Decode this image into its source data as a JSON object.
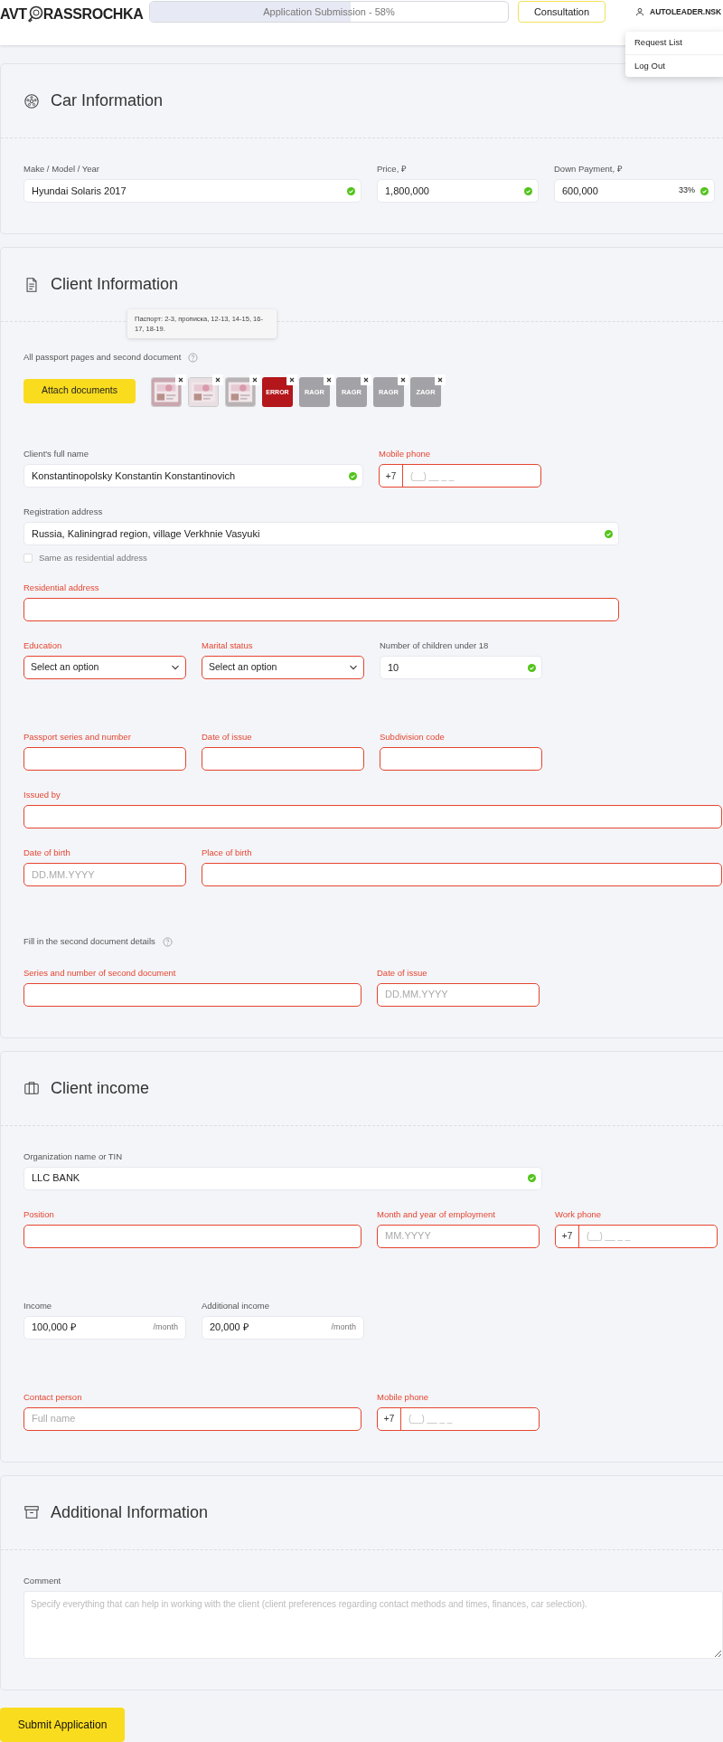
{
  "header": {
    "logo_left": "AVT",
    "logo_right": "RASSROCHKA",
    "progress": {
      "label": "Application Submission - 58%",
      "level": 0.56
    },
    "consultation": "Consultation",
    "user": "AUTOLEADER.NSK",
    "menu": [
      "Request List",
      "Log Out"
    ]
  },
  "sections": [
    {
      "kind": "car",
      "title": "Car Information",
      "groups": [
        {
          "rows": [
            [
              {
                "kind": "text",
                "label": "Make / Model / Year",
                "value": "Hyundai Solaris 2017",
                "valid": true,
                "error": false
              },
              {
                "kind": "text",
                "label": "Price, ₽",
                "value": "1,800,000",
                "valid": true,
                "error": false
              },
              {
                "kind": "text",
                "label": "Down Payment, ₽",
                "value": "600,000",
                "badge": "33%",
                "valid": true,
                "error": false
              }
            ]
          ]
        }
      ]
    },
    {
      "kind": "document",
      "title": "Client Information",
      "documents": {
        "tooltip": "Паспорт: 2-3, прописка, 12-13, 14-15, 16-17, 18-19.",
        "label": "All passport pages and second document",
        "button": "Attach documents",
        "files": [
          {
            "kind": "picture"
          },
          {
            "kind": "picture"
          },
          {
            "kind": "picture"
          },
          {
            "kind": "error",
            "text": "ERROR"
          },
          {
            "kind": "pending",
            "text": "RAGR"
          },
          {
            "kind": "pending",
            "text": "RAGR"
          },
          {
            "kind": "pending",
            "text": "RAGR"
          },
          {
            "kind": "pending",
            "text": "ZAGR"
          }
        ]
      },
      "groups": [
        {
          "rows": [
            [
              {
                "kind": "text",
                "label": "Client's full name",
                "value": "Konstantinopolsky Konstantin Konstantinovich",
                "valid": true,
                "error": false
              },
              {
                "kind": "phone",
                "label": "Mobile phone",
                "prefix": "+7",
                "placeholder": "(__) __ _ _",
                "valid": false,
                "error": true
              }
            ]
          ]
        },
        {
          "rows": [
            [
              {
                "kind": "text",
                "label": "Registration address",
                "value": "Russia, Kaliningrad region, village Verkhnie Vasyuki",
                "valid": true,
                "error": false
              }
            ],
            [
              {
                "kind": "checkbox",
                "label": "Same as residential address",
                "checked": false
              }
            ],
            [
              {
                "kind": "text",
                "label": "Residential address",
                "valid": false,
                "error": true
              }
            ],
            [
              {
                "kind": "select",
                "label": "Education",
                "value": "Select an option",
                "error": true
              },
              {
                "kind": "select",
                "label": "Marital status",
                "value": "Select an option",
                "error": true
              },
              {
                "kind": "text",
                "label": "Number of children under 18",
                "value": "10",
                "valid": true,
                "error": false
              }
            ]
          ]
        },
        {
          "rows": [
            [
              {
                "kind": "text",
                "label": "Passport series and number",
                "valid": false,
                "error": true
              },
              {
                "kind": "text",
                "label": "Date of issue",
                "valid": false,
                "error": true
              },
              {
                "kind": "text",
                "label": "Subdivision code",
                "valid": false,
                "error": true
              }
            ],
            [
              {
                "kind": "text",
                "label": "Issued by",
                "valid": false,
                "error": true
              }
            ],
            [
              {
                "kind": "text",
                "label": "Date of birth",
                "placeholder": "DD.MM.YYYY",
                "valid": false,
                "error": true
              },
              {
                "kind": "text",
                "label": "Place of birth",
                "valid": false,
                "error": true
              }
            ]
          ]
        },
        {
          "rows": [
            [
              {
                "kind": "note",
                "label": "Fill in the second document details"
              }
            ],
            [
              {
                "kind": "text",
                "label": "Series and number of second document",
                "valid": false,
                "error": true
              },
              {
                "kind": "text",
                "label": "Date of issue",
                "placeholder": "DD.MM.YYYY",
                "valid": false,
                "error": true
              }
            ]
          ]
        }
      ]
    },
    {
      "kind": "briefcase",
      "title": "Client income",
      "groups": [
        {
          "rows": [
            [
              {
                "kind": "text",
                "label": "Organization name or TIN",
                "value": "LLC BANK",
                "valid": true,
                "error": false
              }
            ],
            [
              {
                "kind": "text",
                "label": "Position",
                "valid": false,
                "error": true
              },
              {
                "kind": "text",
                "label": "Month and year of employment",
                "placeholder": "MM.YYYY",
                "valid": false,
                "error": true
              },
              {
                "kind": "phone",
                "label": "Work phone",
                "prefix": "+7",
                "placeholder": "(__) __ _ _",
                "valid": false,
                "error": true
              }
            ]
          ]
        },
        {
          "rows": [
            [
              {
                "kind": "money",
                "label": "Income",
                "value": "100,000 ₽",
                "suffix": "/month",
                "valid": false,
                "error": false
              },
              {
                "kind": "money",
                "label": "Additional income",
                "value": "20,000 ₽",
                "suffix": "/month",
                "valid": false,
                "error": false
              }
            ]
          ]
        },
        {
          "rows": [
            [
              {
                "kind": "text",
                "label": "Contact person",
                "placeholder": "Full name",
                "valid": false,
                "error": true
              },
              {
                "kind": "phone",
                "label": "Mobile phone",
                "prefix": "+7",
                "placeholder": "(__) __ _ _",
                "valid": false,
                "error": true
              }
            ]
          ]
        }
      ]
    },
    {
      "kind": "archive",
      "title": "Additional Information",
      "groups": [
        {
          "rows": [
            [
              {
                "kind": "textarea",
                "label": "Comment",
                "placeholder": "Specify everything that can help in working with the client (client preferences regarding contact methods and times, finances, car selection).",
                "error": false
              }
            ]
          ]
        }
      ]
    }
  ],
  "submit": "Submit Application"
}
